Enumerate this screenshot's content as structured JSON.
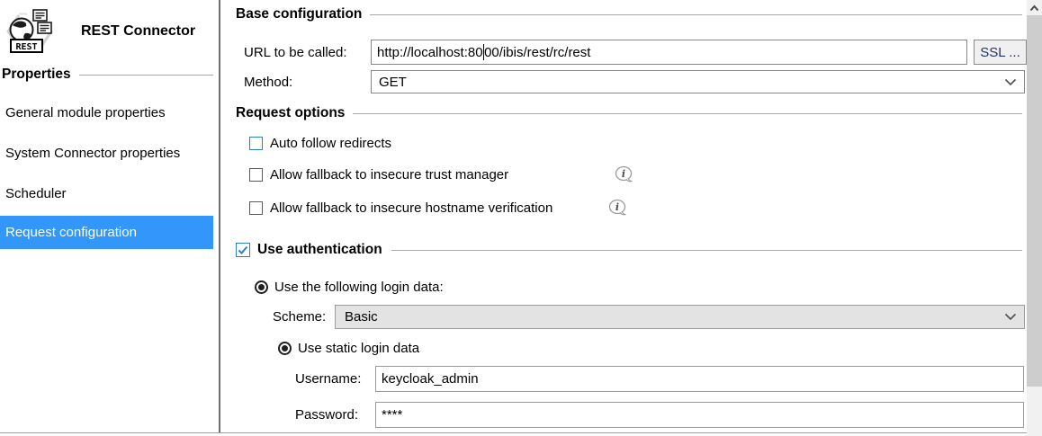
{
  "colors": {
    "selection_blue": "#3296fb",
    "focus_blue": "#2e7dd1"
  },
  "header": {
    "title": "REST Connector",
    "icon_label": "REST"
  },
  "sidebar": {
    "section_title": "Properties",
    "items": [
      {
        "label": "General module properties",
        "selected": false
      },
      {
        "label": "System Connector properties",
        "selected": false
      },
      {
        "label": "Scheduler",
        "selected": false
      },
      {
        "label": "Request configuration",
        "selected": true
      }
    ]
  },
  "base_configuration": {
    "title": "Base configuration",
    "url_label": "URL to be called:",
    "url": {
      "value": "http://localhost:8000/ibis/rest/rc/rest",
      "caret_index": 19
    },
    "ssl_button_label": "SSL ...",
    "method_label": "Method:",
    "method_value": "GET"
  },
  "request_options": {
    "title": "Request options",
    "checkboxes": [
      {
        "label": "Auto follow redirects",
        "checked": false,
        "has_info_icon": false
      },
      {
        "label": "Allow fallback to insecure trust manager",
        "checked": false,
        "has_info_icon": true
      },
      {
        "label": "Allow fallback to insecure hostname verification",
        "checked": false,
        "has_info_icon": true
      }
    ]
  },
  "authentication": {
    "title": "Use authentication",
    "checked": true,
    "login_data_radio_label": "Use the following login data:",
    "login_data_selected": true,
    "scheme_label": "Scheme:",
    "scheme_value": "Basic",
    "static_login_radio_label": "Use static login data",
    "static_login_selected": true,
    "username_label": "Username:",
    "username_value": "keycloak_admin",
    "password_label": "Password:",
    "password_masked_value": "****"
  }
}
